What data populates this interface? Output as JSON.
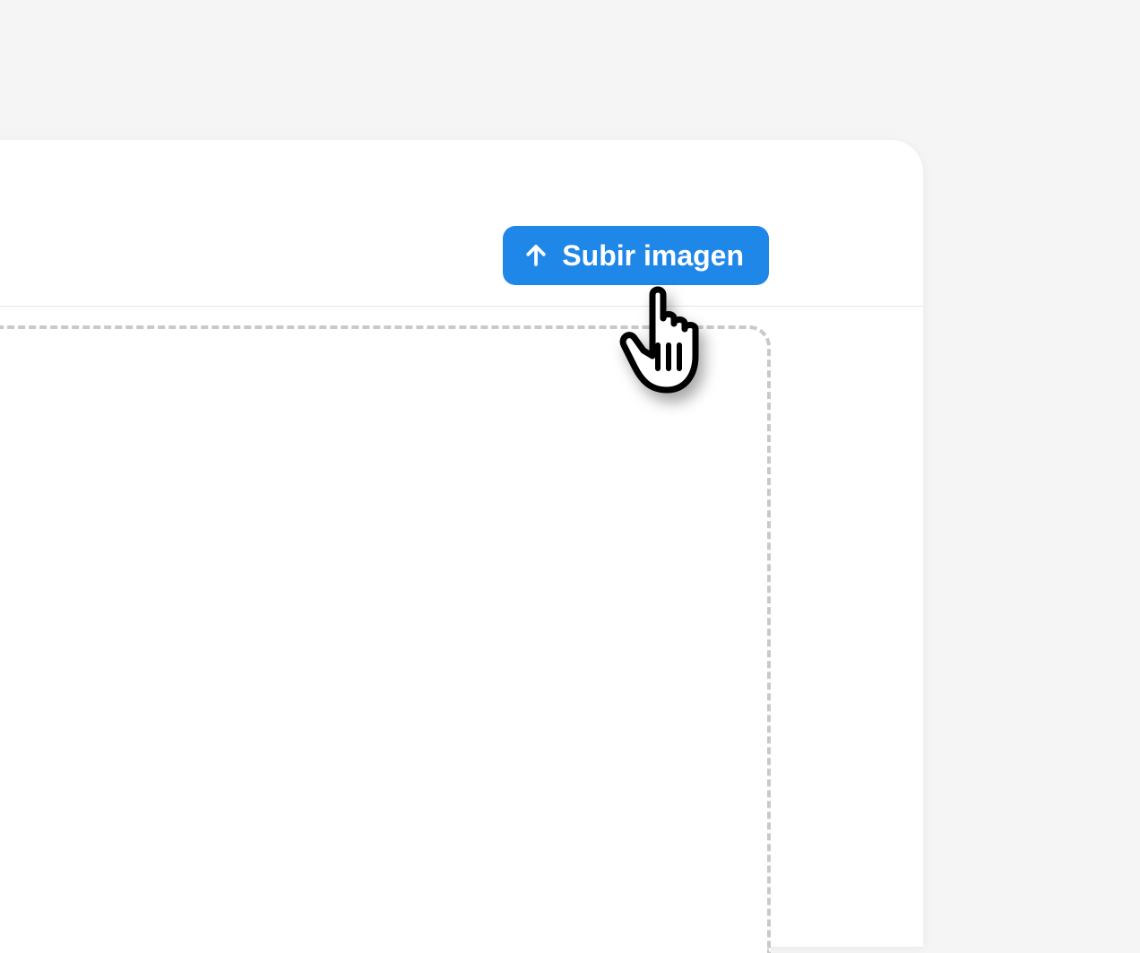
{
  "toolbar": {
    "upload_label": "Subir imagen"
  }
}
